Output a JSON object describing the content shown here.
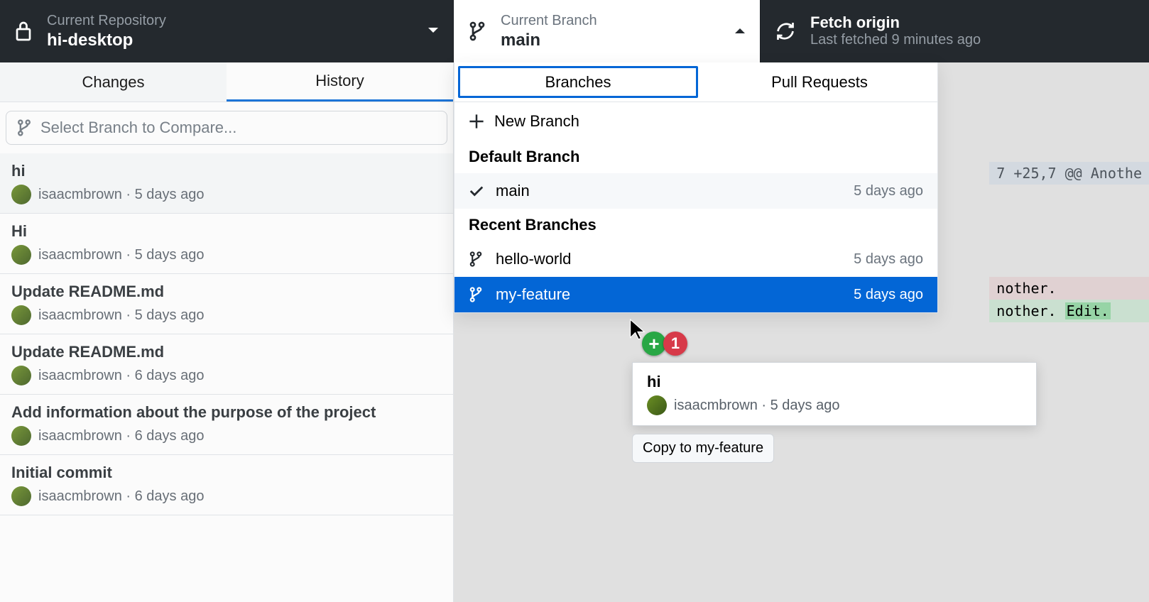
{
  "header": {
    "repo_label": "Current Repository",
    "repo_name": "hi-desktop",
    "branch_label": "Current Branch",
    "branch_name": "main",
    "fetch_title": "Fetch origin",
    "fetch_status": "Last fetched 9 minutes ago"
  },
  "sidebar": {
    "tabs": {
      "changes": "Changes",
      "history": "History"
    },
    "compare_placeholder": "Select Branch to Compare...",
    "commits": [
      {
        "title": "hi",
        "author": "isaacmbrown",
        "time": "5 days ago"
      },
      {
        "title": "Hi",
        "author": "isaacmbrown",
        "time": "5 days ago"
      },
      {
        "title": "Update README.md",
        "author": "isaacmbrown",
        "time": "5 days ago"
      },
      {
        "title": "Update README.md",
        "author": "isaacmbrown",
        "time": "6 days ago"
      },
      {
        "title": "Add information about the purpose of the project",
        "author": "isaacmbrown",
        "time": "6 days ago"
      },
      {
        "title": "Initial commit",
        "author": "isaacmbrown",
        "time": "6 days ago"
      }
    ]
  },
  "dropdown": {
    "tabs": {
      "branches": "Branches",
      "pull_requests": "Pull Requests"
    },
    "new_branch": "New Branch",
    "default_label": "Default Branch",
    "default_branch": {
      "name": "main",
      "time": "5 days ago"
    },
    "recent_label": "Recent Branches",
    "recent": [
      {
        "name": "hello-world",
        "time": "5 days ago"
      },
      {
        "name": "my-feature",
        "time": "5 days ago"
      }
    ]
  },
  "drag": {
    "title": "hi",
    "author": "isaacmbrown",
    "time": "5 days ago",
    "tooltip": "Copy to my-feature",
    "badge_count": "1"
  },
  "diff": {
    "hunk": "7 +25,7 @@ Anothe",
    "line_del": "nother.",
    "line_add_prefix": "nother. ",
    "line_add_suffix": "Edit."
  }
}
